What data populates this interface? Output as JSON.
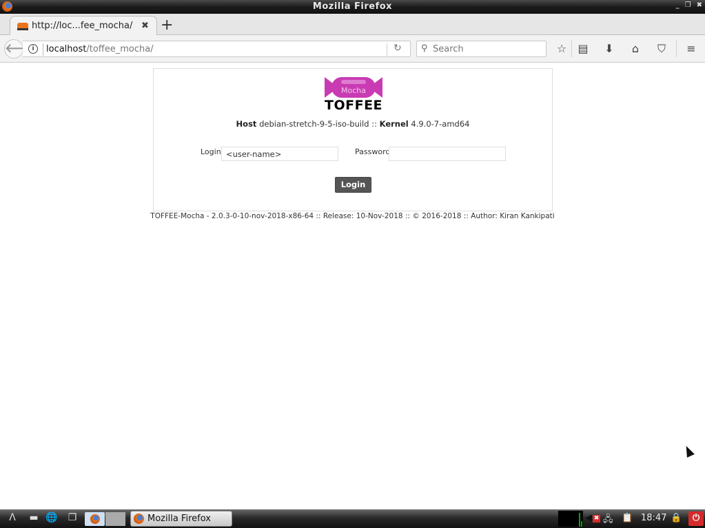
{
  "window": {
    "title": "Mozilla Firefox",
    "controls": [
      "minimize",
      "maximize",
      "close"
    ]
  },
  "tabs": [
    {
      "title": "http://loc...fee_mocha/",
      "favicon": "toffee-favicon",
      "active": true
    }
  ],
  "icons": {
    "tab_close": "✖",
    "new_tab": "+",
    "back": "🡐",
    "info": "i",
    "reload": "↻",
    "search": "🔍",
    "bookmark_star": "☆",
    "reading_list": "▤",
    "downloads": "⬇",
    "home": "⌂",
    "pocket": "⛉",
    "menu": "≡",
    "minimize": "_",
    "maximize": "❐",
    "close": "✖"
  },
  "navbar": {
    "url_host": "localhost",
    "url_path": "/toffee_mocha/",
    "search_placeholder": "Search"
  },
  "page": {
    "logo": {
      "top_text": "Mocha",
      "word": "TOFFEE"
    },
    "host_label": "Host",
    "host_value": "debian-stretch-9-5-iso-build",
    "separator": "::",
    "kernel_label": "Kernel",
    "kernel_value": "4.9.0-7-amd64",
    "login_label": "Login",
    "login_value": "<user-name>",
    "password_label": "Password",
    "password_value": "",
    "login_button": "Login",
    "footer": "TOFFEE-Mocha - 2.0.3-0-10-nov-2018-x86-64 :: Release: 10-Nov-2018 :: © 2016-2018 :: Author: Kiran Kankipati"
  },
  "taskbar": {
    "task_label": "Mozilla Firefox",
    "clock": "18:47"
  }
}
